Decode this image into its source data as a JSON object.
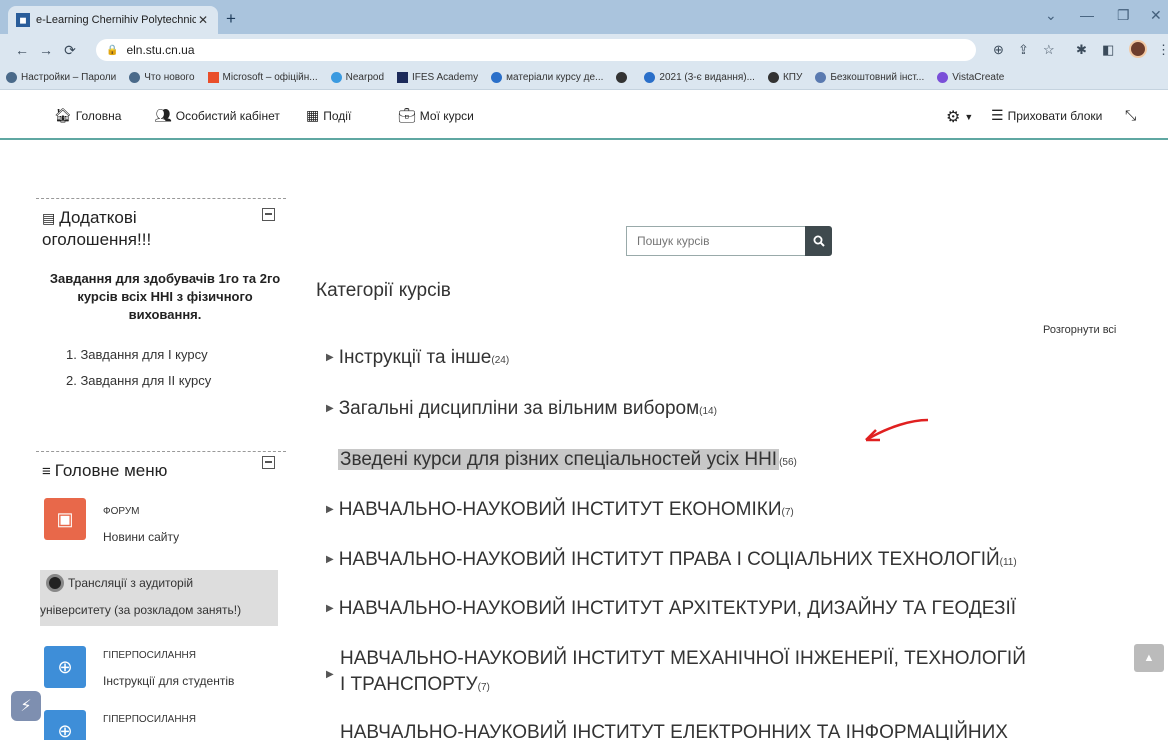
{
  "browser": {
    "tab_title": "e-Learning Chernihiv Polytechnic",
    "new_tab": "+",
    "url": "eln.stu.cn.ua",
    "bookmarks": [
      "Настройки – Пароли",
      "Что нового",
      "Microsoft – офіційн...",
      "Nearpod",
      "IFES Academy",
      "матеріали курсу де...",
      "2021 (3-є видання)...",
      "КПУ",
      "Безкоштовний інст...",
      "VistaCreate"
    ]
  },
  "sitenav": {
    "home": "Головна",
    "cabinet": "Особистий кабінет",
    "events": "Події",
    "my_courses": "Мої курси",
    "hide_blocks": "Приховати блоки"
  },
  "announcements": {
    "title_line1": "Додаткові",
    "title_line2": "оголошення!!!",
    "text": "Завдання для здобувачів 1го та 2го курсів всіх ННІ з фізичного виховання.",
    "items": [
      "1. Завдання для І курсу",
      "2. Завдання для ІІ курсу"
    ]
  },
  "main_menu": {
    "title": "Головне меню",
    "forum_type": "ФОРУМ",
    "forum_link": "Новини сайту",
    "stream_line1": "Трансляції з аудиторій",
    "stream_line2": "університету (за розкладом занять!)",
    "link1_type": "ГІПЕРПОСИЛАННЯ",
    "link1_name": "Інструкції для студентів",
    "link2_type": "ГІПЕРПОСИЛАННЯ"
  },
  "main": {
    "search_placeholder": "Пошук курсів",
    "heading": "Категорії курсів",
    "expand_all": "Розгорнути всі",
    "categories": [
      {
        "name": "Інструкції та інше",
        "count": "(24)"
      },
      {
        "name": "Загальні дисципліни за вільним вибором",
        "count": "(14)"
      },
      {
        "name": "Зведені курси для різних спеціальностей усіх ННІ",
        "count": "(56)"
      },
      {
        "name": "НАВЧАЛЬНО-НАУКОВИЙ ІНСТИТУТ ЕКОНОМІКИ",
        "count": "(7)"
      },
      {
        "name": "НАВЧАЛЬНО-НАУКОВИЙ ІНСТИТУТ ПРАВА І СОЦІАЛЬНИХ ТЕХНОЛОГІЙ",
        "count": "(11)"
      },
      {
        "name": "НАВЧАЛЬНО-НАУКОВИЙ ІНСТИТУТ АРХІТЕКТУРИ, ДИЗАЙНУ ТА ГЕОДЕЗІЇ",
        "count": ""
      },
      {
        "name_line1": "НАВЧАЛЬНО-НАУКОВИЙ ІНСТИТУТ МЕХАНІЧНОЇ ІНЖЕНЕРІЇ, ТЕХНОЛОГІЙ",
        "name_line2": "І ТРАНСПОРТУ",
        "count": "(7)"
      },
      {
        "name": "НАВЧАЛЬНО-НАУКОВИЙ ІНСТИТУТ ЕЛЕКТРОННИХ ТА ІНФОРМАЦІЙНИХ",
        "count": ""
      }
    ]
  },
  "colors": {
    "nav_accent": "#5fa7a2",
    "forum_tile": "#e8684a",
    "link_tile": "#3e8ed8",
    "arrow": "#e02020",
    "highlight": "#c8c8c8"
  }
}
